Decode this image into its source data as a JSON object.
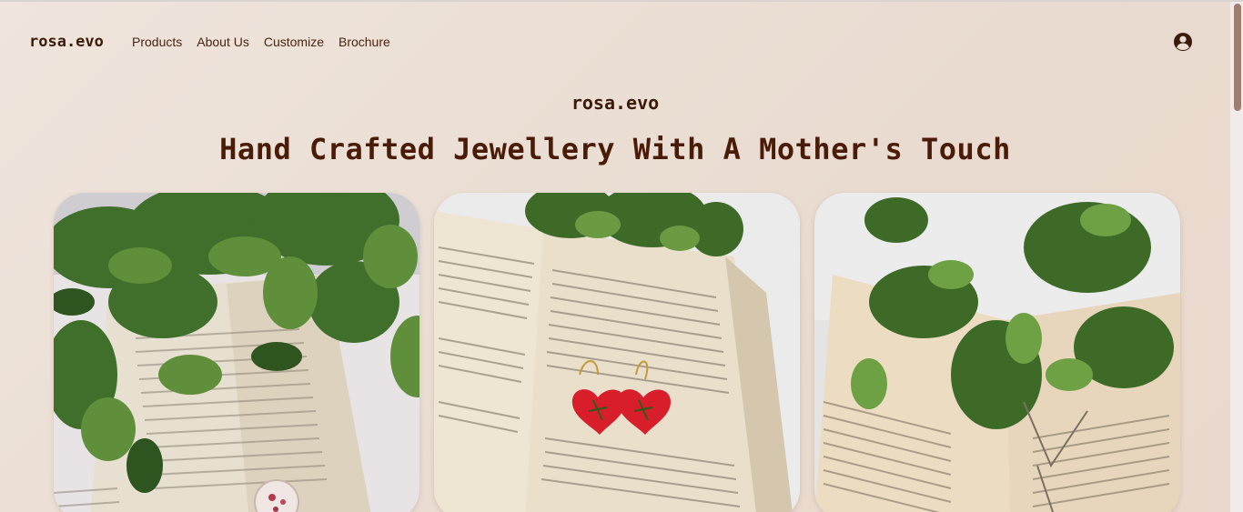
{
  "nav": {
    "brand": "rosa.evo",
    "links": [
      "Products",
      "About Us",
      "Customize",
      "Brochure"
    ],
    "account_icon": "user-circle-icon"
  },
  "hero": {
    "brand": "rosa.evo",
    "title": "Hand Crafted Jewellery With A Mother's Touch"
  },
  "cards": [
    {
      "image": "resin flower pendant on open book with green leaves"
    },
    {
      "image": "red heart resin earrings on open book with leaves"
    },
    {
      "image": "pendant necklace on open book under plant leaves"
    }
  ],
  "colors": {
    "text": "#4a2410",
    "background": "#ece0d6",
    "scroll_thumb": "#a07e6f"
  }
}
